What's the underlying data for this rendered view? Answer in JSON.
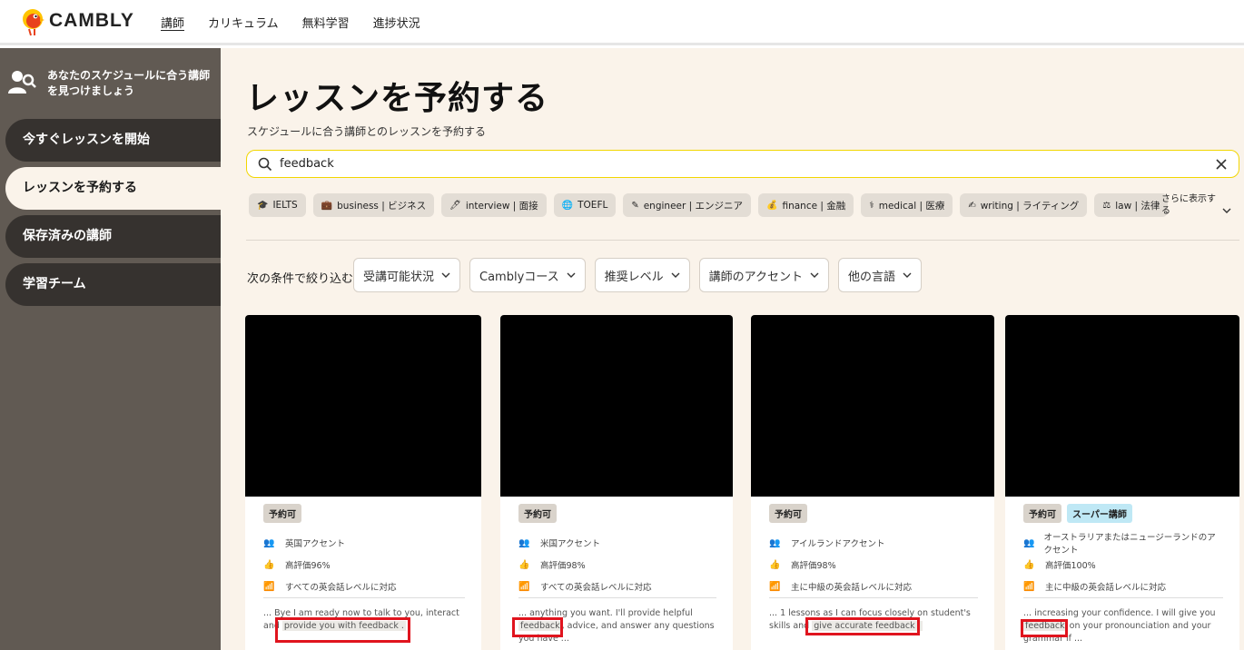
{
  "brand": {
    "name": "CAMBLY"
  },
  "topnav": [
    {
      "label": "講師",
      "active": true
    },
    {
      "label": "カリキュラム"
    },
    {
      "label": "無料学習"
    },
    {
      "label": "進捗状況"
    }
  ],
  "sidebar": {
    "header": "あなたのスケジュールに合う講師を見つけましょう",
    "items": [
      {
        "label": "今すぐレッスンを開始"
      },
      {
        "label": "レッスンを予約する",
        "active": true
      },
      {
        "label": "保存済みの講師"
      },
      {
        "label": "学習チーム"
      }
    ]
  },
  "main": {
    "title": "レッスンを予約する",
    "subtitle": "スケジュールに合う講師とのレッスンを予約する",
    "search": {
      "value": "feedback"
    },
    "chips": [
      {
        "icon": "🎓",
        "label": "IELTS"
      },
      {
        "icon": "💼",
        "label": "business | ビジネス"
      },
      {
        "icon": "🖊",
        "label": "interview | 面接"
      },
      {
        "icon": "🌐",
        "label": "TOEFL"
      },
      {
        "icon": "✎",
        "label": "engineer | エンジニア"
      },
      {
        "icon": "💰",
        "label": "finance | 金融"
      },
      {
        "icon": "⚕",
        "label": "medical | 医療"
      },
      {
        "icon": "✍",
        "label": "writing | ライティング"
      },
      {
        "icon": "⚖",
        "label": "law | 法律"
      }
    ],
    "more_chips": "さらに表示する",
    "filter_label": "次の条件で絞り込む:",
    "filters": [
      {
        "label": "受講可能状況"
      },
      {
        "label": "Camblyコース"
      },
      {
        "label": "推奨レベル"
      },
      {
        "label": "講師のアクセント"
      },
      {
        "label": "他の言語"
      }
    ]
  },
  "cards": [
    {
      "badges": [
        "予約可"
      ],
      "accent": "英国アクセント",
      "rating": "高評価96%",
      "level": "すべての英会話レベルに対応",
      "snippet_pre": "... Bye I am ready now to talk to you, interact and ",
      "snippet_hl": "provide you with  feedback .",
      "snippet_post": ""
    },
    {
      "badges": [
        "予約可"
      ],
      "accent": "米国アクセント",
      "rating": "高評価98%",
      "level": "すべての英会話レベルに対応",
      "snippet_pre": "... anything you want. I'll provide helpful ",
      "snippet_hl": "feedback",
      "snippet_post": ", advice, and answer any questions you have ..."
    },
    {
      "badges": [
        "予約可"
      ],
      "accent": "アイルランドアクセント",
      "rating": "高評価98%",
      "level": "主に中級の英会話レベルに対応",
      "snippet_pre": "... 1 lessons as I can focus closely on student's skills and ",
      "snippet_hl": "give accurate  feedback .",
      "snippet_post": ""
    },
    {
      "badges": [
        "予約可",
        "スーパー講師"
      ],
      "accent": "オーストラリアまたはニュージーランドのアクセント",
      "rating": "高評価100%",
      "level": "主に中級の英会話レベルに対応",
      "snippet_pre": "... increasing your confidence. I will give you ",
      "snippet_hl": "feedback",
      "snippet_post": " on your pronounciation and your grammar if ..."
    }
  ]
}
